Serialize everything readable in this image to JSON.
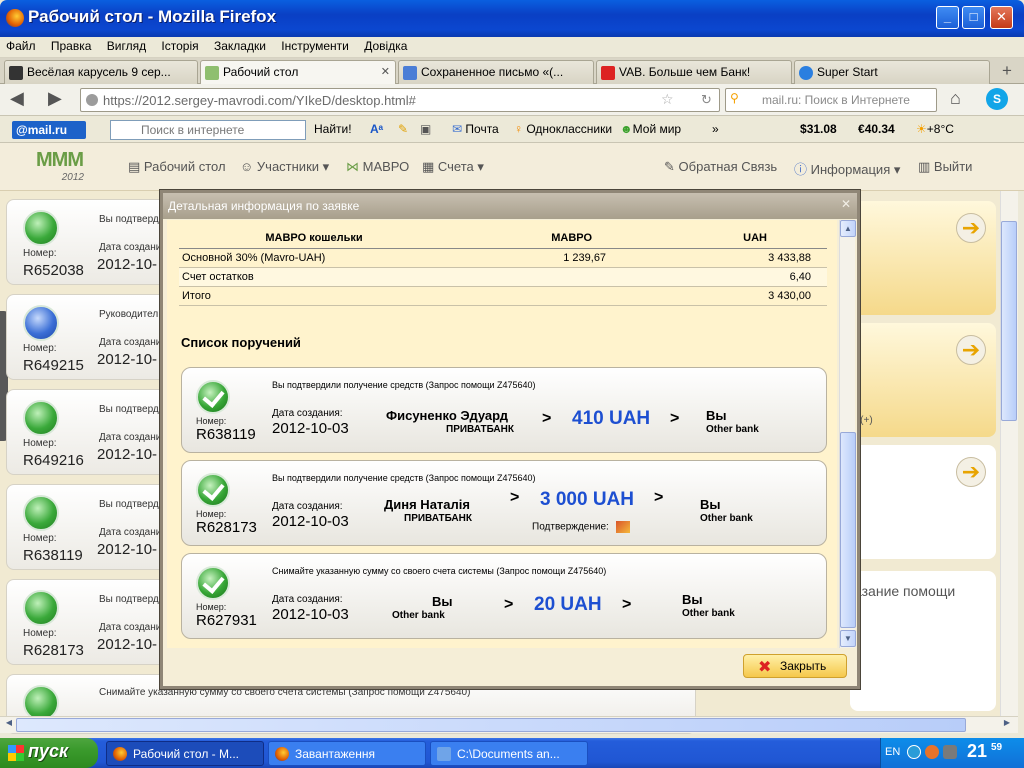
{
  "window": {
    "title": "Рабочий стол - Mozilla Firefox"
  },
  "menu": [
    "Файл",
    "Правка",
    "Вигляд",
    "Історія",
    "Закладки",
    "Інструменти",
    "Довідка"
  ],
  "tabs": [
    {
      "label": "Весёлая карусель 9 сер..."
    },
    {
      "label": "Рабочий стол"
    },
    {
      "label": "Сохраненное письмо «(..."
    },
    {
      "label": "VAB. Больше чем Банк!"
    },
    {
      "label": "Super Start"
    }
  ],
  "nav": {
    "url": "https://2012.sergey-mavrodi.com/YIkeD/desktop.html#",
    "search_placeholder": "mail.ru: Поиск в Интернете"
  },
  "mailbar": {
    "brand": "@mail.ru",
    "search_placeholder": "Поиск в интернете",
    "find": "Найти!",
    "items": [
      "Почта",
      "Одноклассники",
      "Мой мир"
    ],
    "usd": "31.08",
    "eur": "40.34",
    "temp": "+8°C"
  },
  "site": {
    "logo_text": "2012",
    "nav": {
      "desktop": "Рабочий стол",
      "participants": "Участники",
      "mavro": "МАВРО",
      "accounts": "Счета",
      "feedback": "Обратная Связь",
      "info": "Информация",
      "logout": "Выйти"
    }
  },
  "left_cards": [
    {
      "text": "Вы подтверд",
      "label": "Номер:",
      "number": "R652038",
      "date_label": "Дата создани",
      "date": "2012-10-"
    },
    {
      "text": "Руководител",
      "label": "Номер:",
      "number": "R649215",
      "date_label": "Дата создани",
      "date": "2012-10-"
    },
    {
      "text": "Вы подтверд",
      "label": "Номер:",
      "number": "R649216",
      "date_label": "Дата создани",
      "date": "2012-10-"
    },
    {
      "text": "Вы подтверд",
      "label": "Номер:",
      "number": "R638119",
      "date_label": "Дата создани",
      "date": "2012-10-"
    },
    {
      "text": "Вы подтверд",
      "label": "Номер:",
      "number": "R628173",
      "date_label": "Дата создани",
      "date": "2012-10-"
    },
    {
      "text": "Снимайте указанную сумму со своего счета системы (Запрос помощи Z475640)"
    }
  ],
  "right_fragments": [
    "ей",
    "ть",
    "ей",
    "ть",
    "за(+)",
    "ей",
    "ть",
    "азание помощи",
    "ей",
    "ть"
  ],
  "modal": {
    "title": "Детальная информация по заявке",
    "table": {
      "headers": [
        "МАВРО кошельки",
        "МАВРО",
        "UAH"
      ],
      "rows": [
        [
          "Основной 30% (Mavro-UAH)",
          "1 239,67",
          "3 433,88"
        ],
        [
          "Счет остатков",
          "",
          "6,40"
        ],
        [
          "Итого",
          "",
          "3 430,00"
        ]
      ]
    },
    "list_title": "Список поручений",
    "orders": [
      {
        "desc": "Вы подтвердили получение средств (Запрос помощи Z475640)",
        "number_label": "Номер:",
        "number": "R638119",
        "date_label": "Дата создания:",
        "date": "2012-10-03",
        "from_name": "Фисуненко Эдуард",
        "from_bank": "ПРИВАТБАНК",
        "amount": "410 UAH",
        "to_name": "Вы",
        "to_bank": "Other bank",
        "confirm": ""
      },
      {
        "desc": "Вы подтвердили получение средств (Запрос помощи Z475640)",
        "number_label": "Номер:",
        "number": "R628173",
        "date_label": "Дата создания:",
        "date": "2012-10-03",
        "from_name": "Диня Наталія",
        "from_bank": "ПРИВАТБАНК",
        "amount": "3 000 UAH",
        "to_name": "Вы",
        "to_bank": "Other bank",
        "confirm": "Подтверждение:"
      },
      {
        "desc": "Снимайте указанную сумму со своего счета системы (Запрос помощи Z475640)",
        "number_label": "Номер:",
        "number": "R627931",
        "date_label": "Дата создания:",
        "date": "2012-10-03",
        "from_name": "Вы",
        "from_bank": "Other bank",
        "amount": "20 UAH",
        "to_name": "Вы",
        "to_bank": "Other bank",
        "confirm": ""
      }
    ],
    "close": "Закрыть"
  },
  "taskbar": {
    "start": "пуск",
    "items": [
      "Рабочий стол - M...",
      "Завантаження",
      "C:\\Documents an..."
    ],
    "lang": "EN",
    "time": "21",
    "time_min": "59"
  }
}
